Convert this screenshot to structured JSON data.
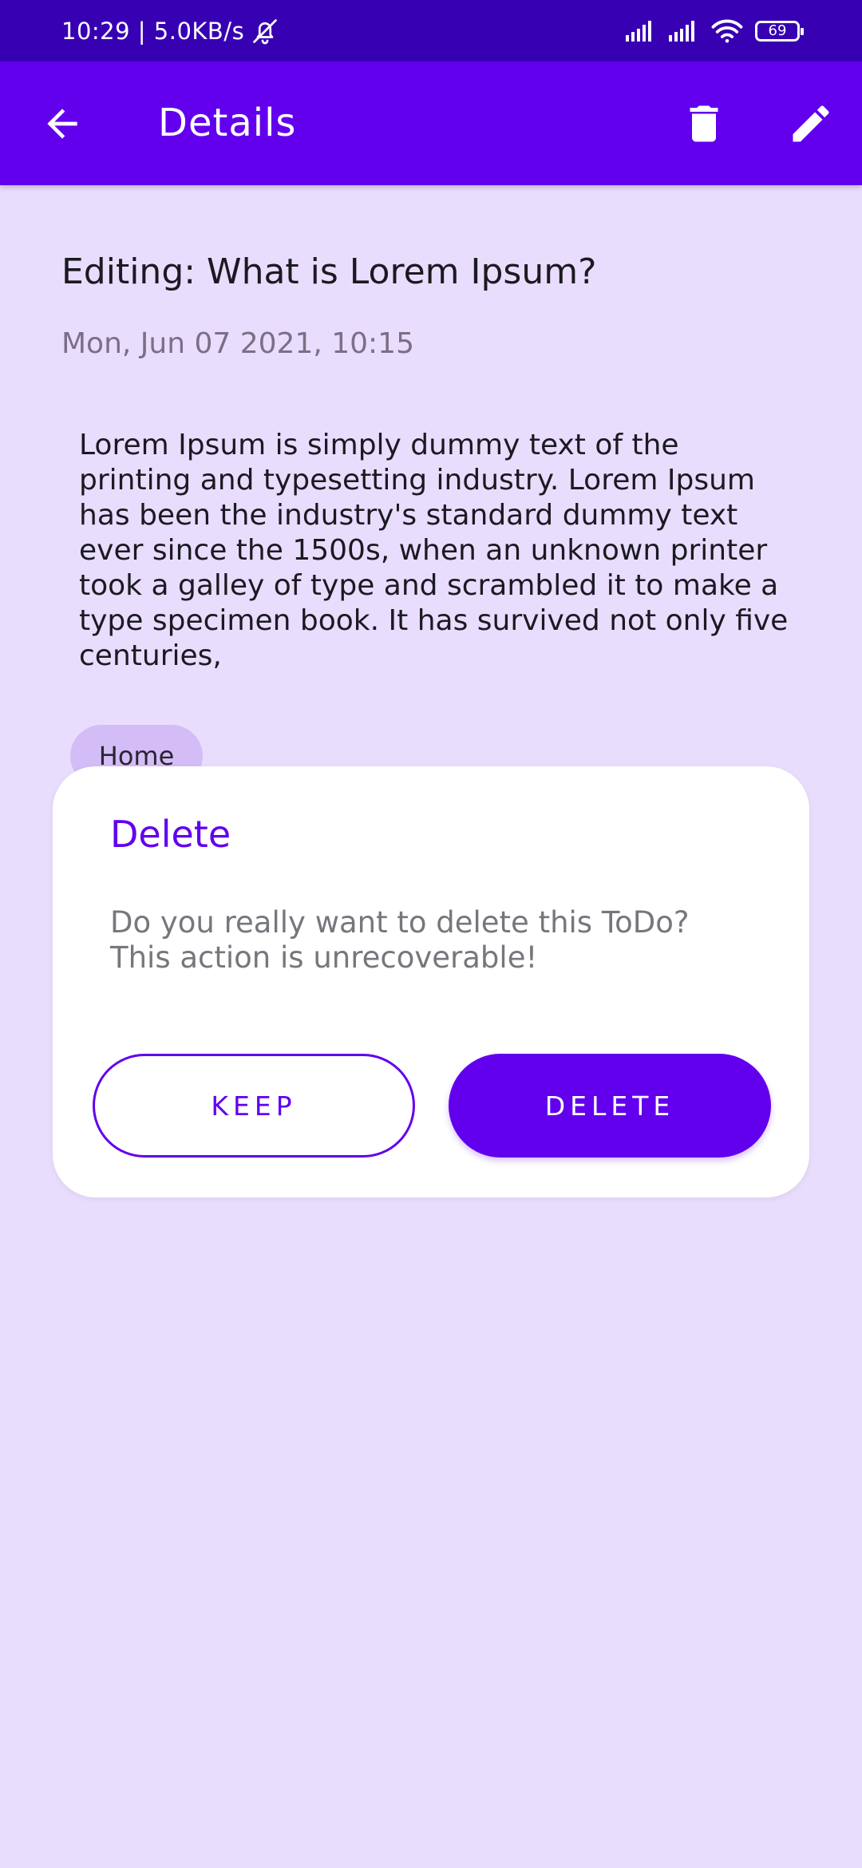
{
  "status_bar": {
    "time_speed": "10:29 | 5.0KB/s",
    "battery": "69"
  },
  "app_bar": {
    "title": "Details"
  },
  "note": {
    "title": "Editing: What is Lorem Ipsum?",
    "date": "Mon, Jun 07 2021, 10:15",
    "body": "Lorem Ipsum is simply dummy text of the printing and typesetting industry. Lorem Ipsum has been the industry's standard dummy text ever since the 1500s, when an unknown printer took a galley of type and scrambled it to make a type specimen book. It has survived not only five centuries,",
    "tag": "Home"
  },
  "dialog": {
    "title": "Delete",
    "message_line1": "Do you really want to delete this ToDo?",
    "message_line2": "This action is unrecoverable!",
    "keep_label": "KEEP",
    "delete_label": "DELETE"
  },
  "colors": {
    "primary": "#6200EE",
    "status_bar": "#3700B3",
    "background": "#E9DDFD",
    "chip": "#D4BDF6"
  }
}
